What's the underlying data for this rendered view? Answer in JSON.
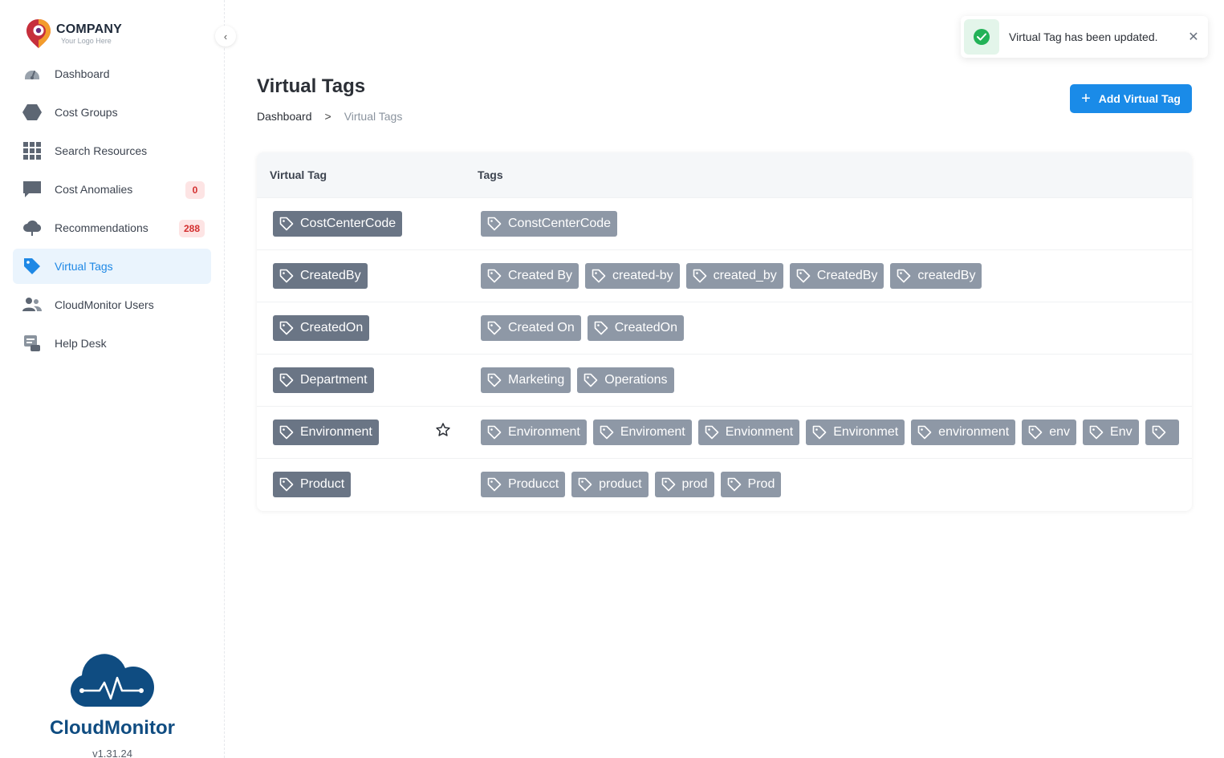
{
  "logo": {
    "name": "COMPANY",
    "tagline": "Your Logo Here"
  },
  "sidebar": {
    "items": [
      {
        "label": "Dashboard",
        "icon": "gauge-icon",
        "badge": ""
      },
      {
        "label": "Cost Groups",
        "icon": "hexagon-icon",
        "badge": ""
      },
      {
        "label": "Search Resources",
        "icon": "grid-icon",
        "badge": ""
      },
      {
        "label": "Cost Anomalies",
        "icon": "chat-bubble-icon",
        "badge": "0"
      },
      {
        "label": "Recommendations",
        "icon": "cloud-icon",
        "badge": "288"
      },
      {
        "label": "Virtual Tags",
        "icon": "tag-icon",
        "badge": ""
      },
      {
        "label": "CloudMonitor Users",
        "icon": "users-icon",
        "badge": ""
      },
      {
        "label": "Help Desk",
        "icon": "help-desk-icon",
        "badge": ""
      }
    ],
    "active_index": 5,
    "brand": "CloudMonitor",
    "version": "v1.31.24"
  },
  "header": {
    "title": "Virtual Tags",
    "breadcrumb": {
      "home": "Dashboard",
      "separator": ">",
      "current": "Virtual Tags"
    },
    "add_button": "Add Virtual Tag"
  },
  "toast": {
    "message": "Virtual Tag has been updated."
  },
  "table": {
    "columns": [
      "Virtual Tag",
      "Tags"
    ],
    "rows": [
      {
        "virtual_tag": "CostCenterCode",
        "starred": false,
        "tags": [
          "ConstCenterCode"
        ]
      },
      {
        "virtual_tag": "CreatedBy",
        "starred": false,
        "tags": [
          "Created By",
          "created-by",
          "created_by",
          "CreatedBy",
          "createdBy"
        ]
      },
      {
        "virtual_tag": "CreatedOn",
        "starred": false,
        "tags": [
          "Created On",
          "CreatedOn"
        ]
      },
      {
        "virtual_tag": "Department",
        "starred": false,
        "tags": [
          "Marketing",
          "Operations"
        ]
      },
      {
        "virtual_tag": "Environment",
        "starred": true,
        "tags": [
          "Environment",
          "Enviroment",
          "Envionment",
          "Environmet",
          "environment",
          "env",
          "Env",
          ""
        ]
      },
      {
        "virtual_tag": "Product",
        "starred": false,
        "tags": [
          "Producct",
          "product",
          "prod",
          "Prod"
        ]
      }
    ]
  },
  "colors": {
    "accent": "#1a8be8",
    "active_nav_bg": "#eaf4fd",
    "chip_primary": "#6a7585",
    "chip_secondary": "#8e98a6",
    "badge_bg": "#fde4e4",
    "badge_text": "#d32f2f",
    "success": "#22b257",
    "brand_blue": "#0f4c81"
  }
}
